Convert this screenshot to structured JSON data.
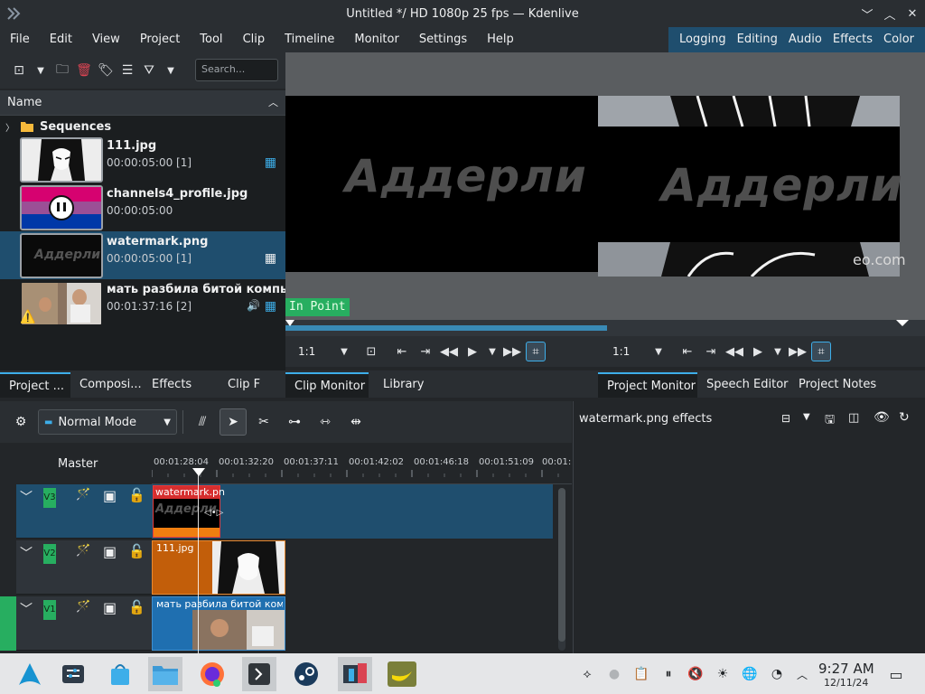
{
  "window": {
    "title": "Untitled */ HD 1080p 25 fps — Kdenlive",
    "minimize": "﹀",
    "maximize": "︿",
    "close": "✕"
  },
  "menu": [
    "File",
    "Edit",
    "View",
    "Project",
    "Tool",
    "Clip",
    "Timeline",
    "Monitor",
    "Settings",
    "Help"
  ],
  "layouts": [
    "Logging",
    "Editing",
    "Audio",
    "Effects",
    "Color"
  ],
  "bin": {
    "search_placeholder": "Search...",
    "header": "Name",
    "folder": "Sequences",
    "clips": [
      {
        "name": "111.jpg",
        "duration": "00:00:05:00 [1]"
      },
      {
        "name": "channels4_profile.jpg",
        "duration": "00:00:05:00"
      },
      {
        "name": "watermark.png",
        "duration": "00:00:05:00 [1]",
        "thumb_text": "Аддерли"
      },
      {
        "name": "мать разбила битой компьют",
        "duration": "00:01:37:16 [2]"
      }
    ],
    "tabs": [
      "Project ...",
      "Composi...",
      "Effects",
      "Clip F"
    ]
  },
  "clip_monitor": {
    "watermark_text": "Аддерли",
    "in_point": "In Point",
    "zoom": "1:1",
    "tabs": [
      "Clip Monitor",
      "Library"
    ]
  },
  "project_monitor": {
    "watermark_text": "Аддерли",
    "site_text": "eo.com",
    "zoom": "1:1",
    "tabs": [
      "Project Monitor",
      "Speech Editor",
      "Project Notes"
    ]
  },
  "timeline": {
    "mode": "Normal Mode",
    "master": "Master",
    "ruler": [
      "00:01:28:04",
      "00:01:32:20",
      "00:01:37:11",
      "00:01:42:02",
      "00:01:46:18",
      "00:01:51:09",
      "00:01:"
    ],
    "tracks": [
      {
        "label": "V3",
        "clip": "watermark.pn",
        "thumb_text": "Аддерли"
      },
      {
        "label": "V2",
        "clip": "111.jpg"
      },
      {
        "label": "V1",
        "clip": "мать разбила битой компь"
      }
    ]
  },
  "effects_panel": {
    "title": "watermark.png effects"
  },
  "taskbar": {
    "time": "9:27 AM",
    "date": "12/11/24"
  },
  "colors": {
    "accent": "#3daee9",
    "selection": "#1f4e6e",
    "track_tag": "#27ae60",
    "clip_orange": "#c25e0a",
    "clip_blue": "#1f6fb0"
  }
}
